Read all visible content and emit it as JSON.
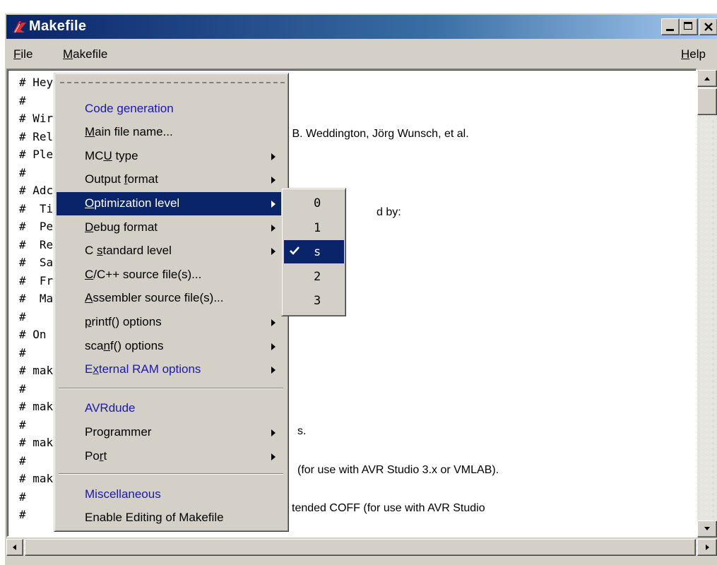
{
  "window": {
    "title": "Makefile"
  },
  "menubar": {
    "file": {
      "mnemonic": "F",
      "rest": "ile"
    },
    "makefile": {
      "mnemonic": "M",
      "rest": "akefile"
    },
    "help": {
      "mnemonic": "H",
      "rest": "elp"
    }
  },
  "editor": {
    "left_lines": [
      "# Hey",
      "#",
      "# Wir",
      "# Rel",
      "# Ple",
      "#",
      "# Adc",
      "#  Tin",
      "#  Pe",
      "#  Re",
      "#  Sa",
      "#  Fre",
      "#  Ma",
      "#",
      "# On",
      "#",
      "# mak",
      "#",
      "# mak",
      "#",
      "# mak",
      "#",
      "# mak",
      "#",
      "#"
    ],
    "fragment_authors": "c B. Weddington, Jörg Wunsch, et al.",
    "fragment_by": "d by:",
    "fragment_s": "s.",
    "fragment_avrstudio": "(for use with AVR Studio 3.x or VMLAB).",
    "fragment_coff": "tended COFF (for use with AVR Studio"
  },
  "makefile_menu": {
    "items": [
      {
        "label": "Code generation"
      },
      {
        "pre": "",
        "mn": "M",
        "post": "ain file name..."
      },
      {
        "pre": "MC",
        "mn": "U",
        "post": " type"
      },
      {
        "pre": "Output ",
        "mn": "f",
        "post": "ormat"
      },
      {
        "pre": "",
        "mn": "O",
        "post": "ptimization level"
      },
      {
        "pre": "",
        "mn": "D",
        "post": "ebug format"
      },
      {
        "pre": "C ",
        "mn": "s",
        "post": "tandard level"
      },
      {
        "pre": "",
        "mn": "C",
        "post": "/C++ source file(s)..."
      },
      {
        "pre": "",
        "mn": "A",
        "post": "ssembler source file(s)..."
      },
      {
        "pre": "",
        "mn": "p",
        "post": "rintf() options"
      },
      {
        "pre": "sca",
        "mn": "n",
        "post": "f() options"
      },
      {
        "pre": "E",
        "mn": "x",
        "post": "ternal RAM options"
      },
      {
        "label": "AVRdude"
      },
      {
        "label": "Programmer"
      },
      {
        "pre": "Po",
        "mn": "r",
        "post": "t"
      },
      {
        "label": "Miscellaneous"
      },
      {
        "label": "Enable Editing of Makefile"
      }
    ]
  },
  "optimization_submenu": {
    "options": [
      "0",
      "1",
      "s",
      "2",
      "3"
    ],
    "selected": "s",
    "check_glyph": "✔"
  },
  "colors": {
    "title_gradient_start": "#0a246a",
    "title_gradient_end": "#a6caf0",
    "highlight": "#0a246a",
    "header_text": "#1a1aa8",
    "chrome": "#d4d0c8"
  }
}
